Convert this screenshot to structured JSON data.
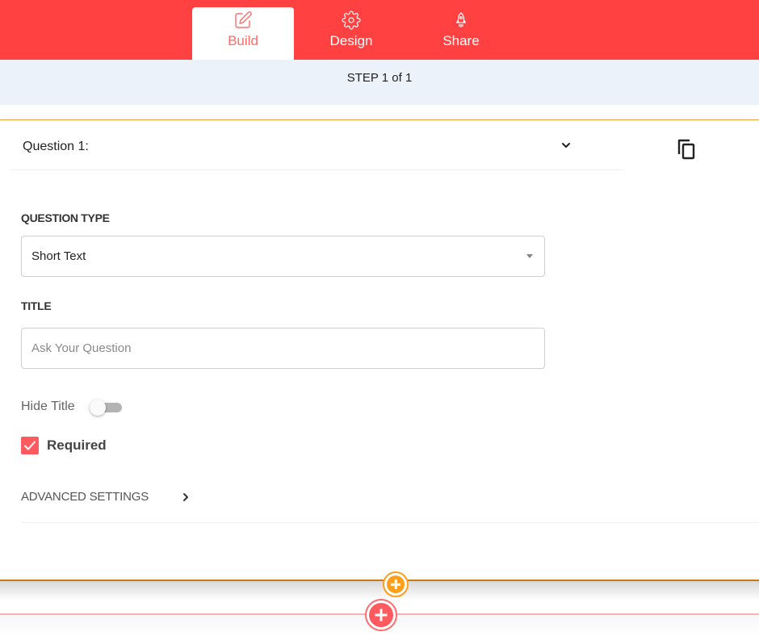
{
  "nav": {
    "tabs": [
      {
        "label": "Build",
        "icon": "edit-icon",
        "active": true
      },
      {
        "label": "Design",
        "icon": "gear-icon",
        "active": false
      },
      {
        "label": "Share",
        "icon": "rocket-icon",
        "active": false
      }
    ]
  },
  "step": {
    "text": "STEP 1 of 1"
  },
  "question": {
    "title": "Question 1:",
    "type_label": "QUESTION TYPE",
    "type_value": "Short Text",
    "title_label": "TITLE",
    "title_value": "",
    "title_placeholder": "Ask Your Question",
    "hide_title_label": "Hide Title",
    "hide_title_on": false,
    "required_label": "Required",
    "required_checked": true,
    "advanced_label": "ADVANCED SETTINGS"
  },
  "colors": {
    "brand": "#ff4141",
    "accent_orange": "#ff9e1b",
    "accent_red": "#ff5a5f",
    "step_bg": "#ebf2f9"
  }
}
